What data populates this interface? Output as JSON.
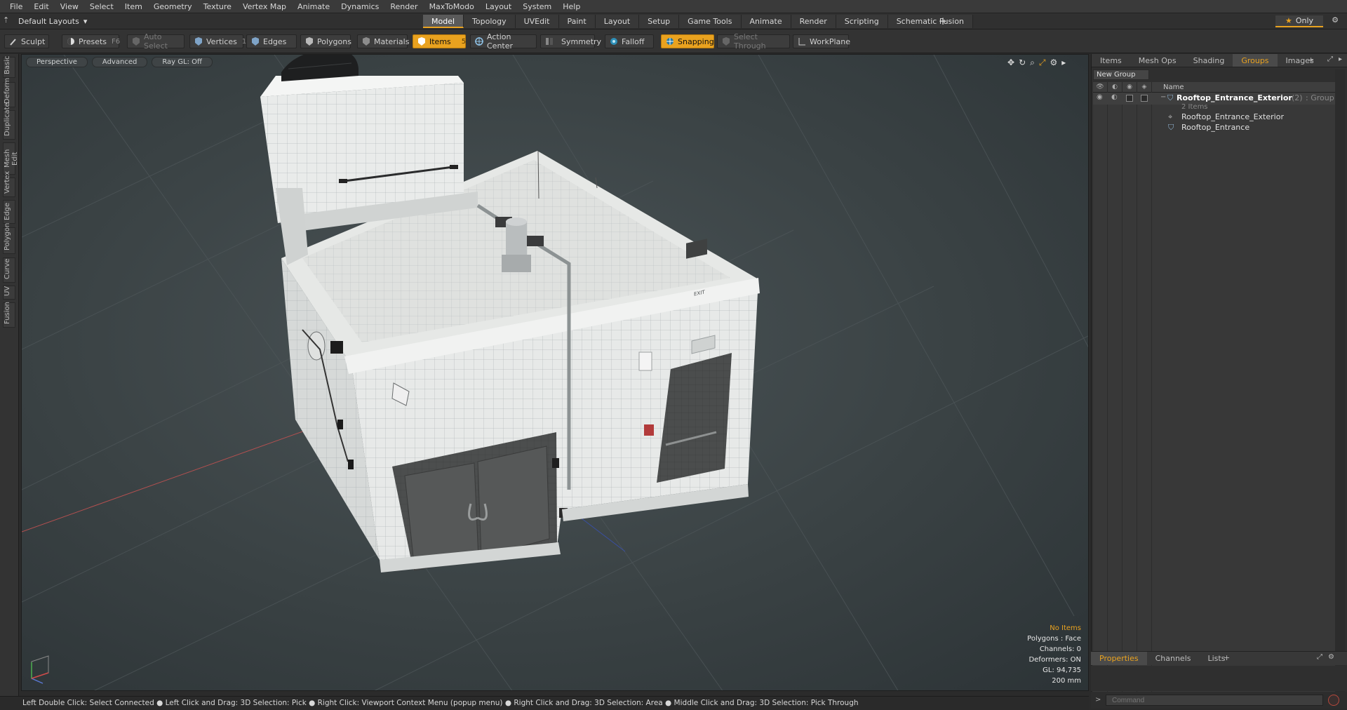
{
  "menu": [
    "File",
    "Edit",
    "View",
    "Select",
    "Item",
    "Geometry",
    "Texture",
    "Vertex Map",
    "Animate",
    "Dynamics",
    "Render",
    "MaxToModo",
    "Layout",
    "System",
    "Help"
  ],
  "layout": {
    "selector": "Default Layouts",
    "tabs": [
      "Model",
      "Topology",
      "UVEdit",
      "Paint",
      "Layout",
      "Setup",
      "Game Tools",
      "Animate",
      "Render",
      "Scripting",
      "Schematic Fusion"
    ],
    "active_tab": "Model",
    "only_label": "Only"
  },
  "toolbar": {
    "sculpt": "Sculpt",
    "presets": "Presets",
    "presets_key": "F6",
    "auto_select": "Auto Select",
    "vertices": "Vertices",
    "vertices_key": "1",
    "edges": "Edges",
    "edges_key": "2",
    "polygons": "Polygons",
    "materials": "Materials",
    "items": "Items",
    "items_key": "5",
    "action_center": "Action Center",
    "symmetry": "Symmetry",
    "falloff": "Falloff",
    "snapping": "Snapping",
    "select_through": "Select Through",
    "workplane": "WorkPlane"
  },
  "left_tabs": [
    "Basic",
    "Deform",
    "Duplicate",
    "Mesh Edit",
    "Vertex",
    "Edge",
    "Polygon",
    "Curve",
    "UV",
    "Fusion"
  ],
  "viewport": {
    "view": "Perspective",
    "shading": "Advanced",
    "raygl": "Ray GL: Off",
    "info": {
      "items": "No Items",
      "polygons": "Polygons : Face",
      "channels": "Channels: 0",
      "deformers": "Deformers: ON",
      "gl": "GL: 94,735",
      "unit": "200 mm"
    },
    "exit_sign": "EXIT"
  },
  "right_panel": {
    "tabs": [
      "Items",
      "Mesh Ops",
      "Shading",
      "Groups",
      "Images"
    ],
    "active_tab": "Groups",
    "new_group": "New Group",
    "name_header": "Name",
    "group_name": "Rooftop_Entrance_Exterior",
    "group_count": "(2)",
    "group_type": ": Group",
    "group_items": "2 Items",
    "children": [
      "Rooftop_Entrance_Exterior",
      "Rooftop_Entrance"
    ],
    "bottom_tabs": [
      "Properties",
      "Channels",
      "Lists"
    ],
    "bottom_active": "Properties",
    "command_placeholder": "Command"
  },
  "status": "Left Double Click: Select Connected ● Left Click and Drag: 3D Selection: Pick ● Right Click: Viewport Context Menu (popup menu) ● Right Click and Drag: 3D Selection: Area ● Middle Click and Drag: 3D Selection: Pick Through",
  "colors": {
    "accent": "#e9a21f",
    "wall": "#e9ebea",
    "door": "#505252"
  }
}
